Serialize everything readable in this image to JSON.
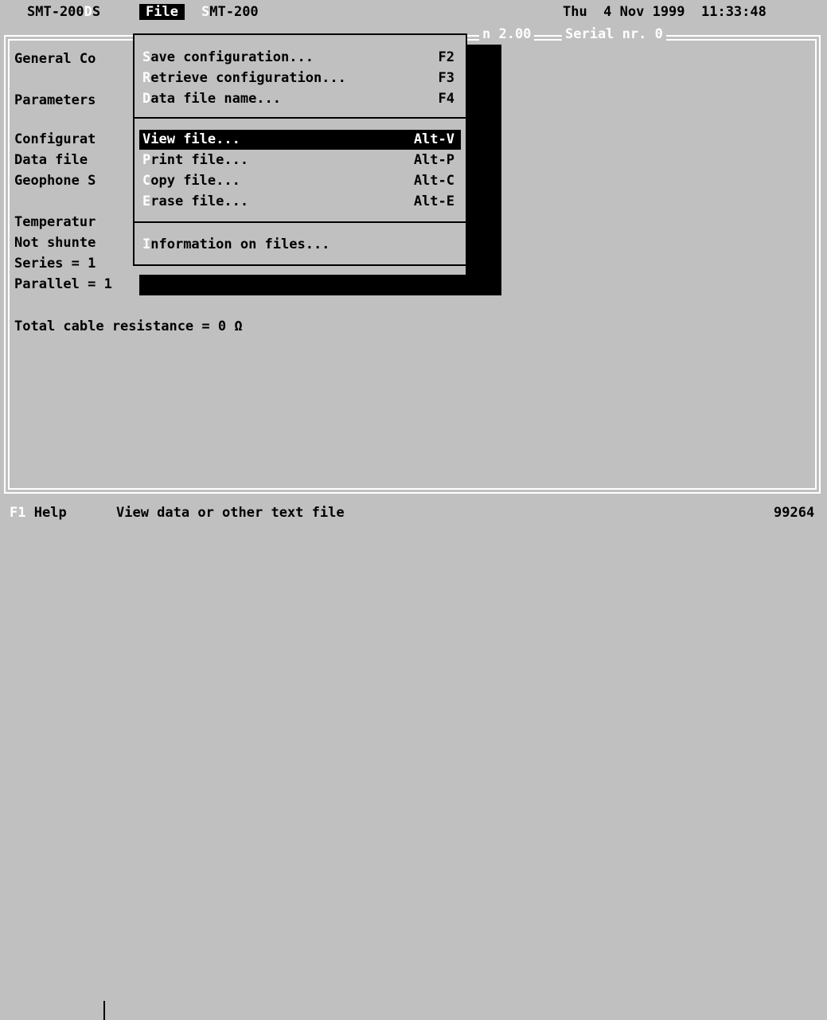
{
  "menubar": {
    "left_prefix": "SMT-200",
    "left_hidden": "D",
    "left_suffix": "S",
    "active_menu": "File",
    "next_hidden": "S",
    "next_label": "MT-200",
    "datetime": "Thu  4 Nov 1999  11:33:48"
  },
  "frame": {
    "version_label": "n 2.00",
    "serial_label": "Serial nr. 0"
  },
  "main": {
    "lines": [
      "General Co",
      "Parameters",
      "Configurat",
      "Data file",
      "Geophone S",
      "Temperatur",
      "Not shunte",
      "Series = 1",
      "Parallel = 1",
      "Total cable resistance = 0 Ω"
    ]
  },
  "dropdown": {
    "items": [
      {
        "hot": "S",
        "rest": "ave configuration...",
        "shortcut": "F2"
      },
      {
        "hot": "R",
        "rest": "etrieve configuration...",
        "shortcut": "F3"
      },
      {
        "hot": "D",
        "rest": "ata file name...",
        "shortcut": "F4"
      },
      {
        "hot": "V",
        "rest": "iew file...",
        "shortcut": "Alt-V"
      },
      {
        "hot": "P",
        "rest": "rint file...",
        "shortcut": "Alt-P"
      },
      {
        "hot": "C",
        "rest": "opy file...",
        "shortcut": "Alt-C"
      },
      {
        "hot": "E",
        "rest": "rase file...",
        "shortcut": "Alt-E"
      },
      {
        "hot": "I",
        "rest": "nformation on files...",
        "shortcut": ""
      }
    ],
    "selected_index": 3
  },
  "statusbar": {
    "key": "F1",
    "help_label": "Help",
    "message": "View data or other text file",
    "right_value": "99264"
  }
}
